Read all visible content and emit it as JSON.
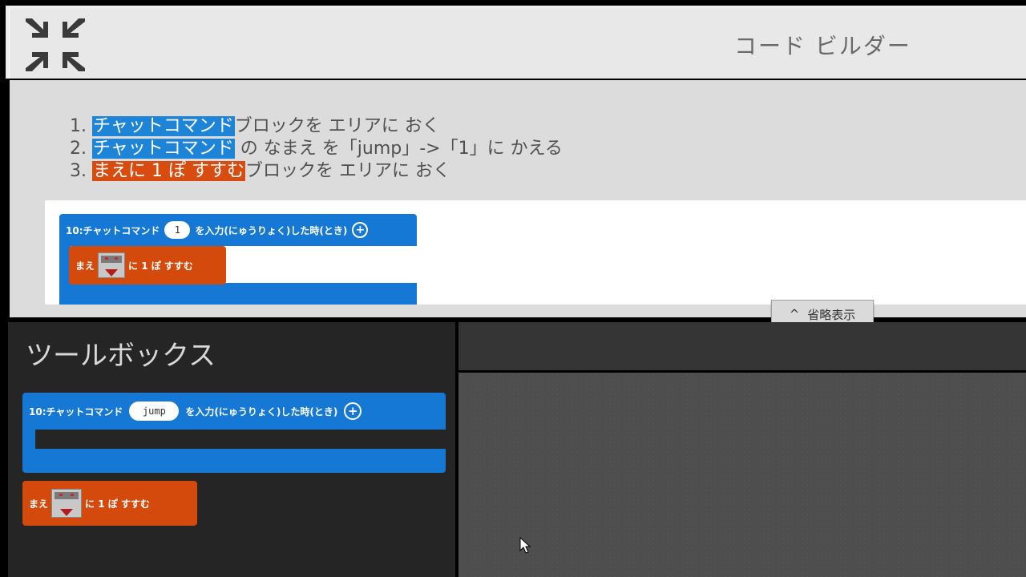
{
  "header": {
    "title": "コード ビルダー",
    "collapse_icon": "collapse-arrows-icon"
  },
  "instructions": {
    "steps": [
      {
        "num": "1.",
        "highlight": "チャットコマンド",
        "highlight_color": "#1e84d8",
        "text": "ブロックを エリアに おく"
      },
      {
        "num": "2.",
        "highlight": "チャットコマンド",
        "highlight_color": "#1e84d8",
        "text": " の なまえ を「jump」->「1」に かえる"
      },
      {
        "num": "3.",
        "highlight": "まえに 1 ぽ すすむ",
        "highlight_color": "#d84c10",
        "text": "ブロックを エリアに おく"
      }
    ],
    "preview": {
      "event_block": {
        "prefix": "10:チャットコマンド",
        "value": "1",
        "suffix": "を入力(にゅうりょく)した時(とき)"
      },
      "move_block": {
        "prefix": "まえ",
        "suffix": "に 1 ぽ すすむ"
      }
    },
    "collapse_button": "省略表示"
  },
  "toolbox": {
    "title": "ツールボックス",
    "event_block": {
      "prefix": "10:チャットコマンド",
      "value": "jump",
      "suffix": "を入力(にゅうりょく)した時(とき)"
    },
    "move_block": {
      "prefix": "まえ",
      "suffix": "に 1 ぽ すすむ"
    }
  },
  "colors": {
    "event_block": "#1478d4",
    "move_block": "#d34a0c"
  }
}
